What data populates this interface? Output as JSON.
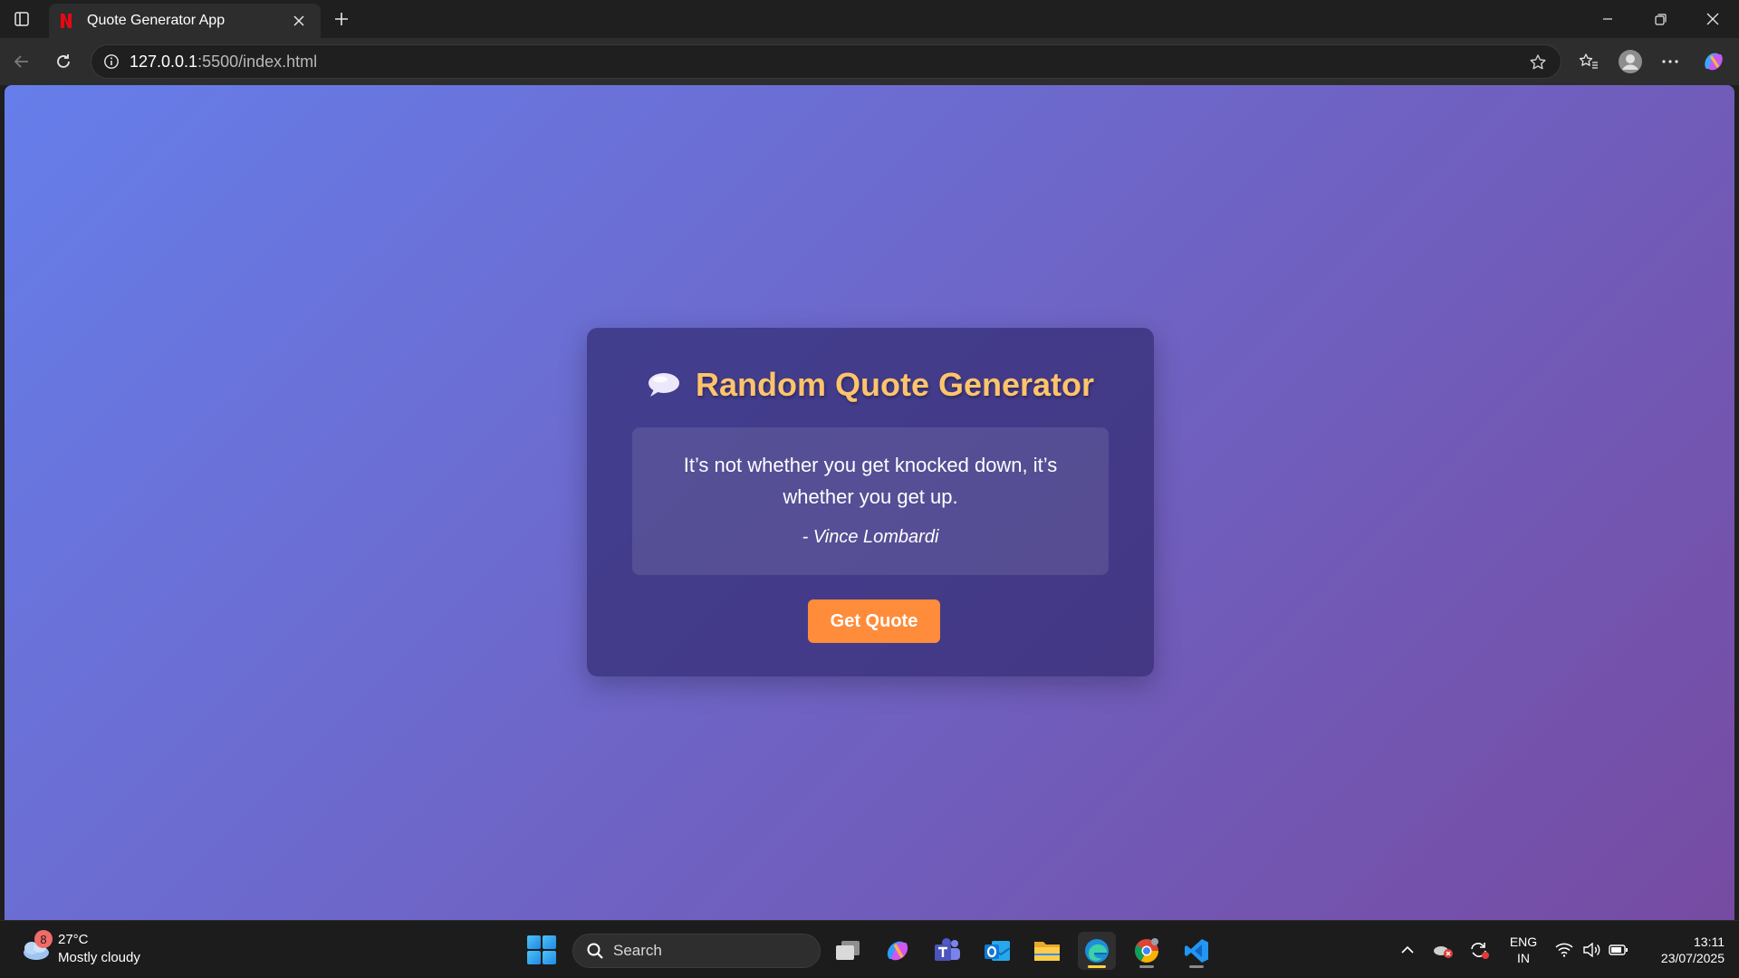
{
  "browser": {
    "tab_title": "Quote Generator App",
    "url_host": "127.0.0.1",
    "url_path": ":5500/index.html"
  },
  "page": {
    "heading": "Random Quote Generator",
    "quote": "It’s not whether you get knocked down, it’s whether you get up.",
    "author": "- Vince Lombardi",
    "button_label": "Get Quote",
    "colors": {
      "gradient_start": "#667eea",
      "gradient_end": "#764ba2",
      "heading": "#ffc46b",
      "button": "#ff8c3a"
    }
  },
  "taskbar": {
    "weather_badge": "8",
    "weather_temp": "27°C",
    "weather_condition": "Mostly cloudy",
    "search_label": "Search",
    "lang_line1": "ENG",
    "lang_line2": "IN",
    "time": "13:11",
    "date": "23/07/2025",
    "pinned_apps": [
      "task-view",
      "copilot",
      "teams",
      "outlook",
      "file-explorer",
      "edge",
      "chrome",
      "vscode"
    ]
  }
}
